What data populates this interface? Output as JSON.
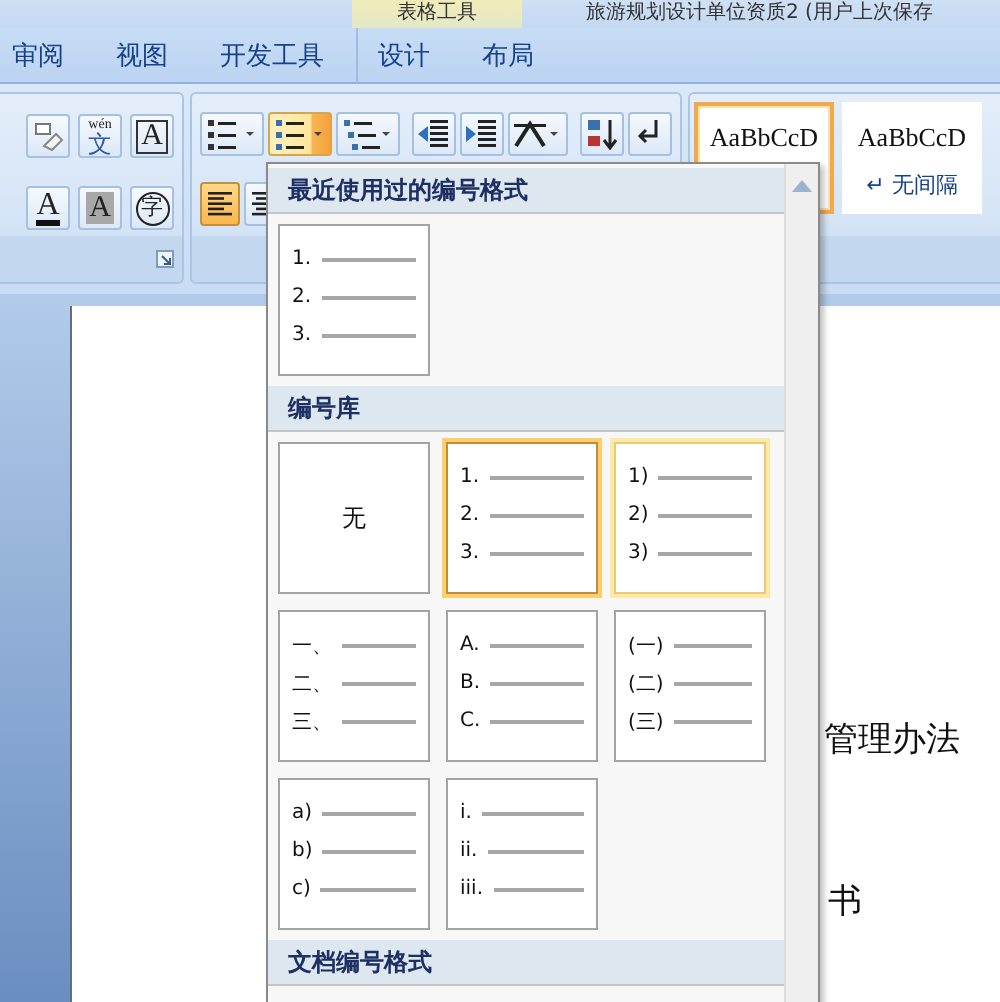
{
  "title_bar": {
    "context_label": "表格工具",
    "document_title": "旅游规划设计单位资质2 (用户上次保存"
  },
  "tabs": [
    {
      "label": "审阅"
    },
    {
      "label": "视图"
    },
    {
      "label": "开发工具"
    }
  ],
  "context_tabs": [
    {
      "label": "设计"
    },
    {
      "label": "布局"
    }
  ],
  "font_buttons": [
    {
      "kind": "clear"
    },
    {
      "kind": "phonetic",
      "glyph": "文",
      "ruby": "wén"
    },
    {
      "kind": "border",
      "glyph": "A"
    },
    {
      "kind": "color",
      "glyph": "A"
    },
    {
      "kind": "shading",
      "glyph": "A"
    },
    {
      "kind": "enclose",
      "glyph": "字"
    }
  ],
  "paragraph_buttons": [
    {
      "kind": "bullets",
      "hovered": false
    },
    {
      "kind": "numbering",
      "hovered": true
    },
    {
      "kind": "multilevel",
      "hovered": false
    },
    {
      "kind": "outdent",
      "hovered": false
    },
    {
      "kind": "indent",
      "hovered": false
    },
    {
      "kind": "layout",
      "hovered": false
    },
    {
      "kind": "sort",
      "hovered": false
    },
    {
      "kind": "marks",
      "hovered": false
    }
  ],
  "align_buttons": [
    {
      "kind": "left",
      "selected": true
    },
    {
      "kind": "center",
      "selected": false
    }
  ],
  "styles": [
    {
      "sample": "AaBbCcD",
      "selected": true
    },
    {
      "sample": "AaBbCcD",
      "name": "↵ 无间隔",
      "selected": false
    }
  ],
  "document": {
    "lines": [
      "管理办法",
      "书"
    ]
  },
  "numbering_menu": {
    "sections": [
      {
        "title": "最近使用过的编号格式",
        "tiles": [
          {
            "kind": "list",
            "labels": [
              "1.",
              "2.",
              "3."
            ],
            "selected": false,
            "hovered": false
          }
        ]
      },
      {
        "title": "编号库",
        "tiles": [
          {
            "kind": "none",
            "label": "无",
            "selected": false,
            "hovered": false
          },
          {
            "kind": "list",
            "labels": [
              "1.",
              "2.",
              "3."
            ],
            "selected": true,
            "hovered": false
          },
          {
            "kind": "list",
            "labels": [
              "1)",
              "2)",
              "3)"
            ],
            "selected": false,
            "hovered": true
          },
          {
            "kind": "list",
            "labels": [
              "一、",
              "二、",
              "三、"
            ],
            "selected": false,
            "hovered": false
          },
          {
            "kind": "list",
            "labels": [
              "A.",
              "B.",
              "C."
            ],
            "selected": false,
            "hovered": false
          },
          {
            "kind": "list",
            "labels": [
              "(一)",
              "(二)",
              "(三)"
            ],
            "selected": false,
            "hovered": false
          },
          {
            "kind": "list",
            "labels": [
              "a)",
              "b)",
              "c)"
            ],
            "selected": false,
            "hovered": false
          },
          {
            "kind": "list",
            "labels": [
              "i.",
              "ii.",
              "iii."
            ],
            "selected": false,
            "hovered": false
          }
        ]
      },
      {
        "title": "文档编号格式"
      }
    ]
  }
}
